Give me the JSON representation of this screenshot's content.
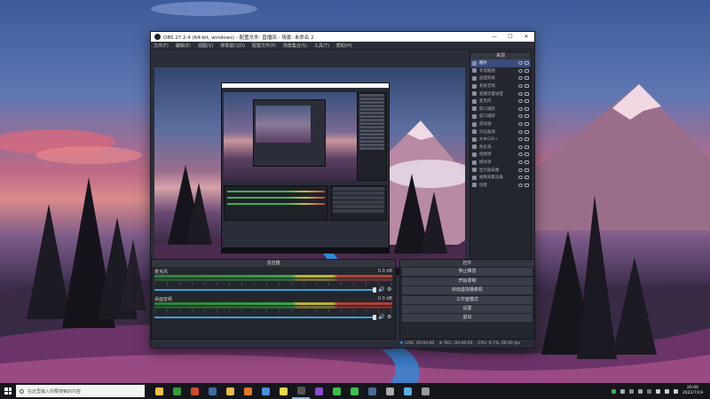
{
  "window": {
    "title": "OBS 27.2.4 (64-bit, windows) - 配置文件: 直播间 - 场景: 未命名 2",
    "min_icon": "minimize-icon",
    "max_icon": "maximize-icon",
    "close_icon": "close-icon"
  },
  "menu": [
    "文件(F)",
    "编辑(E)",
    "视图(V)",
    "停靠窗口(D)",
    "配置文件(P)",
    "场景集合(S)",
    "工具(T)",
    "帮助(H)"
  ],
  "sources": {
    "title": "来源",
    "items": [
      {
        "label": "图片",
        "selected": true
      },
      {
        "label": "有电脑图"
      },
      {
        "label": "画面贴纸"
      },
      {
        "label": "系统音频"
      },
      {
        "label": "直播流量进度"
      },
      {
        "label": "麦克风"
      },
      {
        "label": "窗口捕获"
      },
      {
        "label": "窗口捕获"
      },
      {
        "label": "游戏源"
      },
      {
        "label": "浏览器源"
      },
      {
        "label": "文本GDI+"
      },
      {
        "label": "色彩源"
      },
      {
        "label": "视频源"
      },
      {
        "label": "媒体源"
      },
      {
        "label": "显示器采集"
      },
      {
        "label": "视频采集设备"
      },
      {
        "label": "场景"
      }
    ],
    "tools": [
      "+",
      "−",
      "⚙",
      "∧",
      "∨"
    ]
  },
  "mixer": {
    "title": "混音器",
    "channels": [
      {
        "name": "麦克风",
        "db": "0.0 dB"
      },
      {
        "name": "桌面音频",
        "db": "0.0 dB"
      }
    ]
  },
  "controls": {
    "title": "控件",
    "buttons": [
      "停止推流",
      "开始录制",
      "启动虚拟摄像机",
      "工作室模式",
      "设置",
      "退出"
    ]
  },
  "status": {
    "live": "LIVE: 00:00:00",
    "rec": "REC: 00:00:00",
    "cpu": "CPU: 9.7%, 60.00 fps"
  },
  "taskbar": {
    "search_placeholder": "在这里输入你要搜索的内容",
    "time": "20:06",
    "date": "2022/7/19",
    "apps": [
      {
        "icon": "file-explorer-icon",
        "color": "#f0c040"
      },
      {
        "icon": "xbox-icon",
        "color": "#3a9a3a"
      },
      {
        "icon": "office-icon",
        "color": "#d04a2a"
      },
      {
        "icon": "steam-icon",
        "color": "#3a6aa0"
      },
      {
        "icon": "folder-icon",
        "color": "#e8b84a"
      },
      {
        "icon": "app-icon",
        "color": "#e07a2a"
      },
      {
        "icon": "chrome-icon",
        "color": "#4a90e2"
      },
      {
        "icon": "notes-icon",
        "color": "#e8d84a"
      },
      {
        "icon": "obs-icon",
        "color": "#555"
      },
      {
        "icon": "app-icon",
        "color": "#8a4ad0"
      },
      {
        "icon": "wechat-icon",
        "color": "#3ac04a"
      },
      {
        "icon": "message-icon",
        "color": "#3ac04a"
      },
      {
        "icon": "steam-icon",
        "color": "#4a6a9a"
      },
      {
        "icon": "app-icon",
        "color": "#aaa"
      },
      {
        "icon": "app-icon",
        "color": "#5ab0e0"
      },
      {
        "icon": "gauge-icon",
        "color": "#999"
      }
    ],
    "tray": [
      {
        "icon": "tray-green-icon",
        "color": "#3ab04a"
      },
      {
        "icon": "tray-icon",
        "color": "#aaa"
      },
      {
        "icon": "tray-icon",
        "color": "#888"
      },
      {
        "icon": "tray-icon",
        "color": "#aaa"
      },
      {
        "icon": "tray-icon",
        "color": "#777"
      },
      {
        "icon": "network-icon",
        "color": "#ccc"
      },
      {
        "icon": "volume-icon",
        "color": "#ccc"
      },
      {
        "icon": "ime-icon",
        "color": "#ccc"
      }
    ]
  }
}
